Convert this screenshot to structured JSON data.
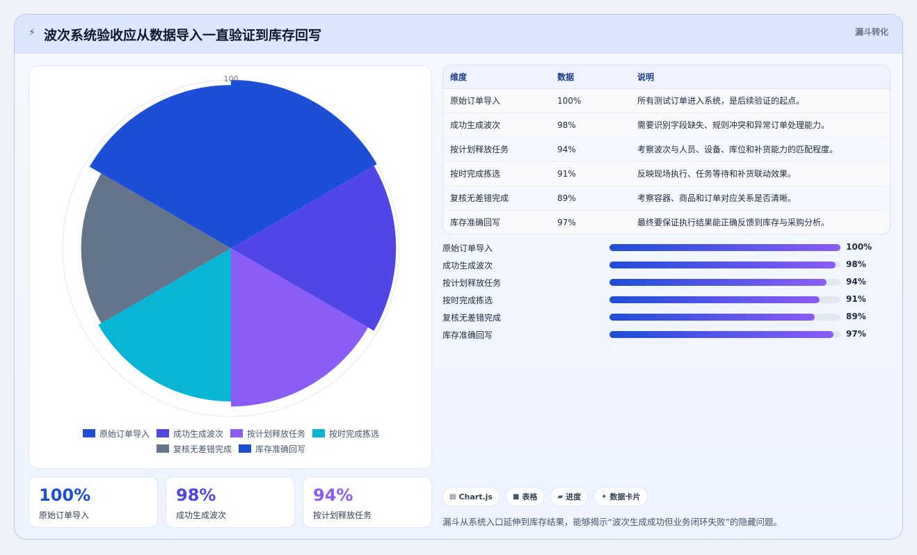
{
  "header": {
    "title": "波次系统验收应从数据导入一直验证到库存回写",
    "tag": "漏斗转化"
  },
  "colors": {
    "slices": [
      "#1d4fd6",
      "#4f46e5",
      "#8b5cf6",
      "#06b6d4",
      "#64748b",
      "#1d4fd6"
    ]
  },
  "chart_data": {
    "type": "polarArea",
    "categories": [
      "原始订单导入",
      "成功生成波次",
      "按计划释放任务",
      "按时完成拣选",
      "复核无差错完成",
      "库存准确回写"
    ],
    "values": [
      100,
      98,
      94,
      91,
      89,
      97
    ],
    "r_tick_labels": [
      "100"
    ],
    "rmax": 100
  },
  "kpis": [
    {
      "value": "100%",
      "label": "原始订单导入",
      "color": "#1d4fd6"
    },
    {
      "value": "98%",
      "label": "成功生成波次",
      "color": "#4f46e5"
    },
    {
      "value": "94%",
      "label": "按计划释放任务",
      "color": "#8b5cf6"
    }
  ],
  "table": {
    "headers": [
      "维度",
      "数据",
      "说明"
    ],
    "rows": [
      [
        "原始订单导入",
        "100%",
        "所有测试订单进入系统，是后续验证的起点。"
      ],
      [
        "成功生成波次",
        "98%",
        "需要识别字段缺失、规则冲突和异常订单处理能力。"
      ],
      [
        "按计划释放任务",
        "94%",
        "考察波次与人员、设备、库位和补货能力的匹配程度。"
      ],
      [
        "按时完成拣选",
        "91%",
        "反映现场执行、任务等待和补货联动效果。"
      ],
      [
        "复核无差错完成",
        "89%",
        "考察容器、商品和订单对应关系是否清晰。"
      ],
      [
        "库存准确回写",
        "97%",
        "最终要保证执行结果能正确反馈到库存与采购分析。"
      ]
    ]
  },
  "progress": [
    {
      "label": "原始订单导入",
      "pct": "100%",
      "value": 100
    },
    {
      "label": "成功生成波次",
      "pct": "98%",
      "value": 98
    },
    {
      "label": "按计划释放任务",
      "pct": "94%",
      "value": 94
    },
    {
      "label": "按时完成拣选",
      "pct": "91%",
      "value": 91
    },
    {
      "label": "复核无差错完成",
      "pct": "89%",
      "value": 89
    },
    {
      "label": "库存准确回写",
      "pct": "97%",
      "value": 97
    }
  ],
  "chips": [
    {
      "icon": "chart-icon",
      "glyph": "▤",
      "label": "Chart.js"
    },
    {
      "icon": "table-icon",
      "glyph": "■",
      "label": "表格"
    },
    {
      "icon": "progress-icon",
      "glyph": "▰",
      "label": "进度"
    },
    {
      "icon": "sparkle-icon",
      "glyph": "✦",
      "label": "数据卡片"
    }
  ],
  "note": "漏斗从系统入口延伸到库存结果，能够揭示“波次生成成功但业务闭环失败”的隐藏问题。"
}
